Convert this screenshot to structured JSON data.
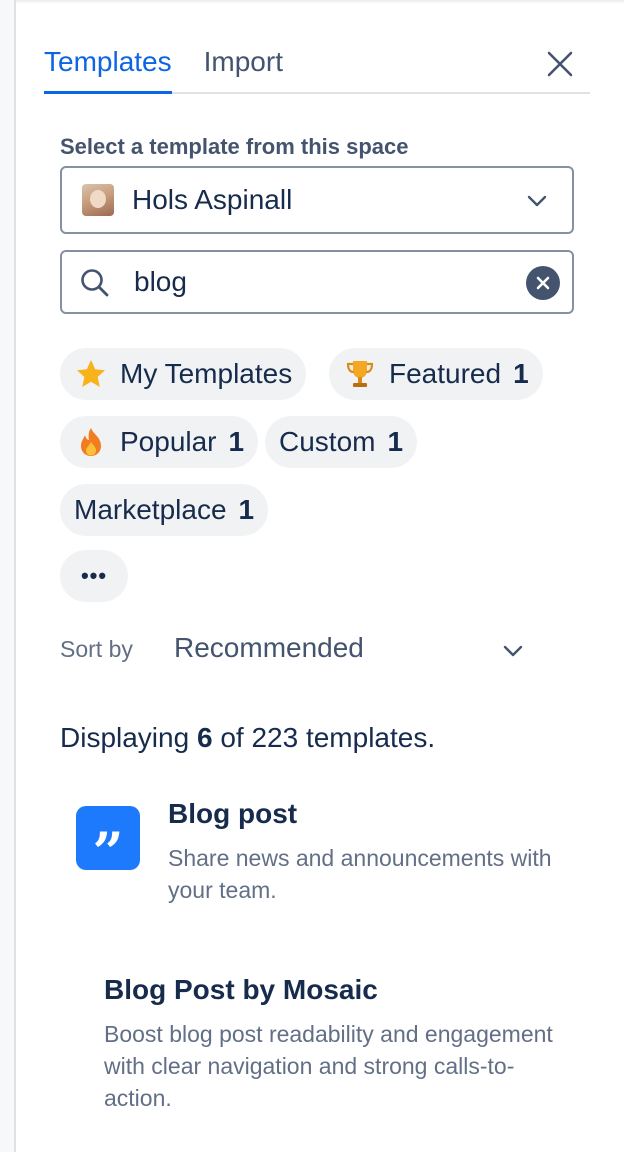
{
  "tabs": [
    {
      "label": "Templates",
      "active": true
    },
    {
      "label": "Import",
      "active": false
    }
  ],
  "icons": {
    "close": "close-icon",
    "search": "search-icon",
    "clear": "clear-icon",
    "chevron": "chevron-down-icon"
  },
  "space_section": {
    "label": "Select a template from this space",
    "selected_space": "Hols Aspinall"
  },
  "search": {
    "value": "blog"
  },
  "filters": [
    {
      "label": "My Templates",
      "count": "",
      "icon": "star-icon"
    },
    {
      "label": "Featured",
      "count": "1",
      "icon": "trophy-icon"
    },
    {
      "label": "Popular",
      "count": "1",
      "icon": "fire-icon"
    },
    {
      "label": "Custom",
      "count": "1",
      "icon": ""
    },
    {
      "label": "Marketplace",
      "count": "1",
      "icon": ""
    }
  ],
  "more_filters": "•••",
  "sort": {
    "label": "Sort by",
    "value": "Recommended"
  },
  "results": {
    "prefix": "Displaying",
    "shown": "6",
    "suffix": "of 223 templates."
  },
  "templates": [
    {
      "title": "Blog post",
      "description": "Share news and announcements with your team.",
      "icon": "quote-icon",
      "icon_glyph": "”"
    },
    {
      "title": "Blog Post by Mosaic",
      "description": "Boost blog post readability and engagement with clear navigation and strong calls-to-action.",
      "icon": ""
    }
  ],
  "colors": {
    "accent": "#0c66e4",
    "template_icon_bg": "#1d7afc",
    "chip_bg": "#f1f2f4",
    "text_primary": "#172b4d",
    "text_subtle": "#626f86"
  }
}
